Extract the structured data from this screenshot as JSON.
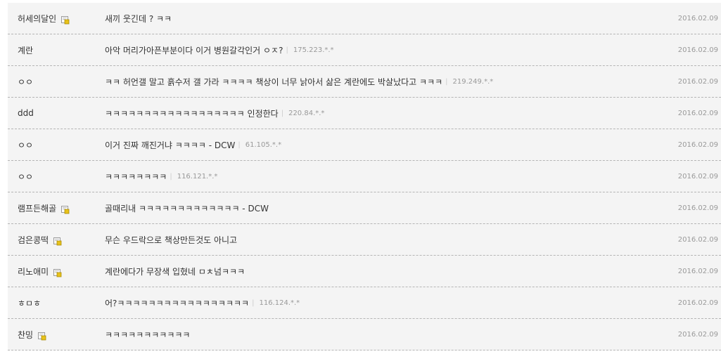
{
  "comments": [
    {
      "nick": "허세의달인",
      "gonic": true,
      "text": "새끼 웃긴데 ? ㅋㅋ",
      "ip": "",
      "date": "2016.02.09"
    },
    {
      "nick": "계란",
      "gonic": false,
      "text": "아악 머리가아픈부분이다 이거 병원갈각인거 ㅇㅈ?",
      "ip": "175.223.*.*",
      "date": "2016.02.09"
    },
    {
      "nick": "ㅇㅇ",
      "gonic": false,
      "text": "ㅋㅋ 허언갤 말고 흙수저 갤 가라 ㅋㅋㅋㅋ 책상이 너무 낡아서 삶은 계란에도 박살났다고 ㅋㅋㅋ",
      "ip": "219.249.*.*",
      "date": "2016.02.09"
    },
    {
      "nick": "ddd",
      "gonic": false,
      "text": "ㅋㅋㅋㅋㅋㅋㅋㅋㅋㅋㅋㅋㅋㅋㅋㅋㅋㅋ 인정한다",
      "ip": "220.84.*.*",
      "date": "2016.02.09"
    },
    {
      "nick": "ㅇㅇ",
      "gonic": false,
      "text": "이거 진짜 깨진거냐 ㅋㅋㅋㅋ - DCW",
      "ip": "61.105.*.*",
      "date": "2016.02.09"
    },
    {
      "nick": "ㅇㅇ",
      "gonic": false,
      "text": "ㅋㅋㅋㅋㅋㅋㅋㅋ",
      "ip": "116.121.*.*",
      "date": "2016.02.09"
    },
    {
      "nick": "램프든해골",
      "gonic": true,
      "text": "골때리내 ㅋㅋㅋㅋㅋㅋㅋㅋㅋㅋㅋㅋㅋ - DCW",
      "ip": "",
      "date": "2016.02.09"
    },
    {
      "nick": "검은콩떡",
      "gonic": true,
      "text": "무슨 우드락으로 책상만든것도 아니고",
      "ip": "",
      "date": "2016.02.09"
    },
    {
      "nick": "리노애미",
      "gonic": true,
      "text": "계란에다가 무장색 입혔네 ㅁㅊ넘ㅋㅋㅋ",
      "ip": "",
      "date": "2016.02.09"
    },
    {
      "nick": "ㅎㅁㅎ",
      "gonic": false,
      "text": "어?ㅋㅋㅋㅋㅋㅋㅋㅋㅋㅋㅋㅋㅋㅋㅋㅋㅋ",
      "ip": "116.124.*.*",
      "date": "2016.02.09"
    },
    {
      "nick": "찬밍",
      "gonic": true,
      "text": "ㅋㅋㅋㅋㅋㅋㅋㅋㅋㅋㅋ",
      "ip": "",
      "date": "2016.02.09"
    }
  ],
  "icons": {
    "gonic": "fixed-nick-badge-icon"
  },
  "colors": {
    "background": "#f4f4f4",
    "divider": "#b5b5b5",
    "muted": "#999999",
    "text": "#333333",
    "badge": "#e8c21a"
  }
}
